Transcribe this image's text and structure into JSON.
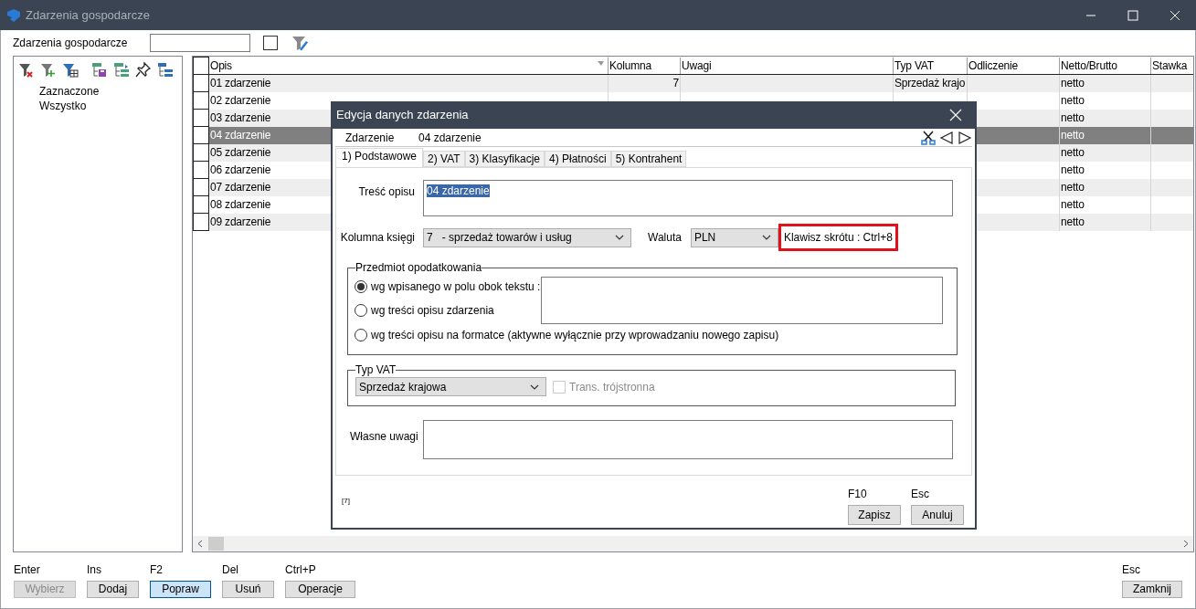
{
  "window": {
    "title": "Zdarzenia gospodarcze"
  },
  "filter_bar": {
    "label": "Zdarzenia gospodarcze",
    "checked": false
  },
  "tree": {
    "items": [
      {
        "label": "Zaznaczone"
      },
      {
        "label": "Wszystko"
      }
    ]
  },
  "table": {
    "columns": [
      {
        "label": "Opis",
        "sort_icon": true
      },
      {
        "label": "Kolumna"
      },
      {
        "label": "Uwagi"
      },
      {
        "label": "Typ VAT"
      },
      {
        "label": "Odliczenie"
      },
      {
        "label": "Netto/Brutto"
      },
      {
        "label": "Stawka"
      }
    ],
    "rows": [
      {
        "cells": [
          "01 zdarzenie",
          "7",
          null,
          "Sprzedaż krajo",
          null,
          "netto",
          null
        ],
        "selected": false
      },
      {
        "cells": [
          "02 zdarzenie",
          null,
          null,
          null,
          null,
          "netto",
          null
        ],
        "selected": false
      },
      {
        "cells": [
          "03 zdarzenie",
          null,
          null,
          null,
          null,
          "netto",
          null
        ],
        "selected": false
      },
      {
        "cells": [
          "04 zdarzenie",
          null,
          null,
          null,
          null,
          "netto",
          null
        ],
        "selected": true
      },
      {
        "cells": [
          "05 zdarzenie",
          null,
          null,
          null,
          null,
          "netto",
          null
        ],
        "selected": false
      },
      {
        "cells": [
          "06 zdarzenie",
          null,
          null,
          null,
          null,
          "netto",
          null
        ],
        "selected": false
      },
      {
        "cells": [
          "07 zdarzenie",
          null,
          null,
          null,
          null,
          "netto",
          null
        ],
        "selected": false
      },
      {
        "cells": [
          "08 zdarzenie",
          null,
          null,
          null,
          null,
          "netto",
          null
        ],
        "selected": false
      },
      {
        "cells": [
          "09 zdarzenie",
          null,
          null,
          null,
          null,
          "netto",
          null
        ],
        "selected": false
      }
    ]
  },
  "buttons": [
    {
      "key": "Enter",
      "label": "Wybierz",
      "disabled": true,
      "focused": false
    },
    {
      "key": "Ins",
      "label": "Dodaj",
      "disabled": false,
      "focused": false
    },
    {
      "key": "F2",
      "label": "Popraw",
      "disabled": false,
      "focused": true
    },
    {
      "key": "Del",
      "label": "Usuń",
      "disabled": false,
      "focused": false
    },
    {
      "key": "Ctrl+P",
      "label": "Operacje",
      "disabled": false,
      "focused": false
    }
  ],
  "close_button": {
    "key": "Esc",
    "label": "Zamknij"
  },
  "dialog": {
    "title": "Edycja danych zdarzenia",
    "record_label": "Zdarzenie",
    "record_value": "04 zdarzenie",
    "tabs": [
      {
        "label": "1) Podstawowe",
        "selected": true
      },
      {
        "label": "2) VAT",
        "selected": false
      },
      {
        "label": "3) Klasyfikacje",
        "selected": false
      },
      {
        "label": "4) Płatności",
        "selected": false
      },
      {
        "label": "5) Kontrahent",
        "selected": false
      }
    ],
    "description": {
      "label": "Treść opisu",
      "value": "04 zdarzenie",
      "highlighted": true
    },
    "book_column": {
      "label": "Kolumna księgi",
      "value": "7   - sprzedaż towarów i usług"
    },
    "currency": {
      "label": "Waluta",
      "value": "PLN"
    },
    "shortcut": "Klawisz skrótu : Ctrl+8",
    "taxation": {
      "legend": "Przedmiot opodatkowania",
      "options": [
        {
          "label": "wg wpisanego w polu obok tekstu :",
          "selected": true
        },
        {
          "label": "wg treści opisu zdarzenia",
          "selected": false
        },
        {
          "label": "wg treści opisu na formatce (aktywne wyłącznie przy wprowadzaniu nowego zapisu)",
          "selected": false
        }
      ]
    },
    "vat_type": {
      "legend": "Typ VAT",
      "value": "Sprzedaż krajowa",
      "trilateral": {
        "label": "Trans. trójstronna",
        "checked": false,
        "disabled": true
      }
    },
    "notes_label": "Własne uwagi",
    "footer_mark": "[7]",
    "buttons": [
      {
        "key": "F10",
        "label": "Zapisz"
      },
      {
        "key": "Esc",
        "label": "Anuluj"
      }
    ]
  }
}
